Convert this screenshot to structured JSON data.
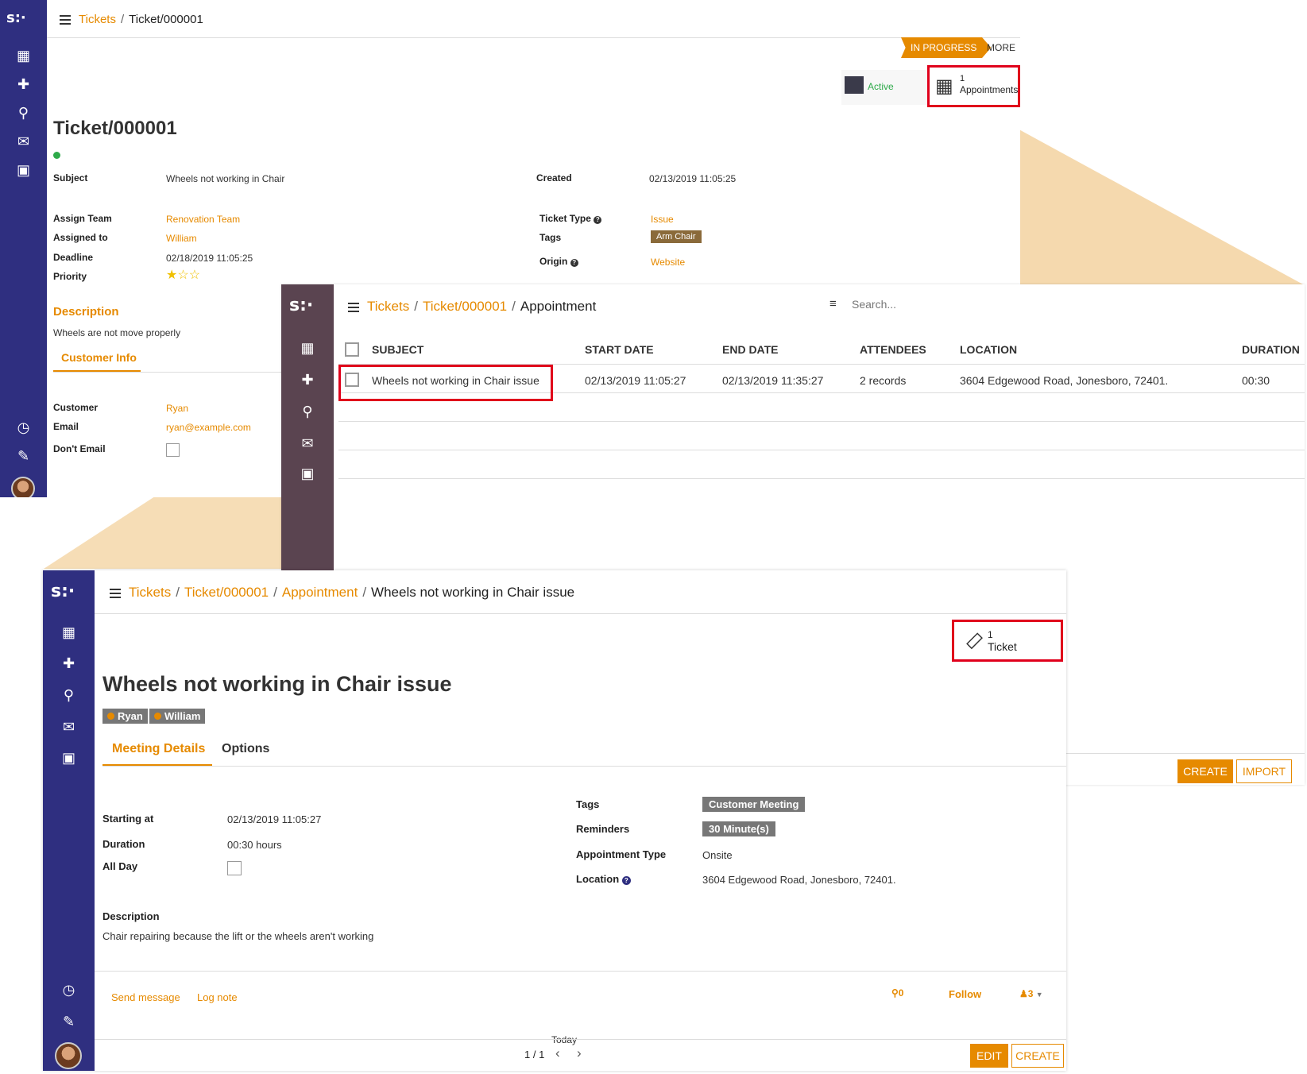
{
  "back_panel": {
    "breadcrumb": {
      "tickets": "Tickets",
      "current": "Ticket/000001"
    },
    "status": {
      "in_progress": "IN PROGRESS",
      "more": "MORE"
    },
    "smart_buttons": {
      "active": "Active",
      "appointments_count": "1",
      "appointments": "Appointments"
    },
    "title": "Ticket/000001",
    "fields": {
      "subject_label": "Subject",
      "subject": "Wheels not working in Chair",
      "assign_team_label": "Assign Team",
      "assign_team": "Renovation Team",
      "assigned_to_label": "Assigned to",
      "assigned_to": "William",
      "deadline_label": "Deadline",
      "deadline": "02/18/2019 11:05:25",
      "priority_label": "Priority",
      "created_label": "Created",
      "created": "02/13/2019 11:05:25",
      "ticket_type_label": "Ticket Type",
      "ticket_type": "Issue",
      "tags_label": "Tags",
      "tag": "Arm Chair",
      "origin_label": "Origin",
      "origin": "Website"
    },
    "priority_stars": {
      "filled": 1,
      "total": 3
    },
    "description_title": "Description",
    "description": "Wheels are not move properly",
    "tab_customer_info": "Customer Info",
    "customer": {
      "customer_label": "Customer",
      "customer": "Ryan",
      "email_label": "Email",
      "email": "ryan@example.com",
      "dont_email_label": "Don't Email"
    }
  },
  "middle_panel": {
    "breadcrumb": {
      "tickets": "Tickets",
      "ticket": "Ticket/000001",
      "current": "Appointment"
    },
    "search_placeholder": "Search...",
    "columns": [
      "SUBJECT",
      "START DATE",
      "END DATE",
      "ATTENDEES",
      "LOCATION",
      "DURATION"
    ],
    "rows": [
      [
        "Wheels not working in Chair issue",
        "02/13/2019 11:05:27",
        "02/13/2019 11:35:27",
        "2 records",
        "3604 Edgewood Road, Jonesboro, 72401.",
        "00:30"
      ]
    ],
    "create": "CREATE",
    "import": "IMPORT"
  },
  "front_panel": {
    "breadcrumb": {
      "tickets": "Tickets",
      "ticket": "Ticket/000001",
      "appointment": "Appointment",
      "current": "Wheels not working in Chair issue"
    },
    "smart_button": {
      "count": "1",
      "label": "Ticket"
    },
    "title": "Wheels not working in Chair issue",
    "attendees": [
      "Ryan",
      "William"
    ],
    "tabs": {
      "meeting_details": "Meeting Details",
      "options": "Options"
    },
    "fields": {
      "starting_at_label": "Starting at",
      "starting_at": "02/13/2019 11:05:27",
      "duration_label": "Duration",
      "duration": "00:30 hours",
      "all_day_label": "All Day",
      "tags_label": "Tags",
      "tag": "Customer Meeting",
      "reminders_label": "Reminders",
      "reminder": "30 Minute(s)",
      "appointment_type_label": "Appointment Type",
      "appointment_type": "Onsite",
      "location_label": "Location",
      "location": "3604 Edgewood Road, Jonesboro, 72401."
    },
    "description_label": "Description",
    "description": "Chair repairing because the lift or the wheels aren't working",
    "chatter": {
      "send_message": "Send message",
      "log_note": "Log note",
      "attachments": "0",
      "follow": "Follow",
      "followers": "3",
      "today": "Today"
    },
    "pager": "1 / 1",
    "edit": "EDIT",
    "create": "CREATE"
  },
  "colors": {
    "sidebar": "#2f2f80",
    "accent": "#e68a00",
    "highlight": "#e0001b",
    "zoom_fill": "#f5d9ae"
  }
}
